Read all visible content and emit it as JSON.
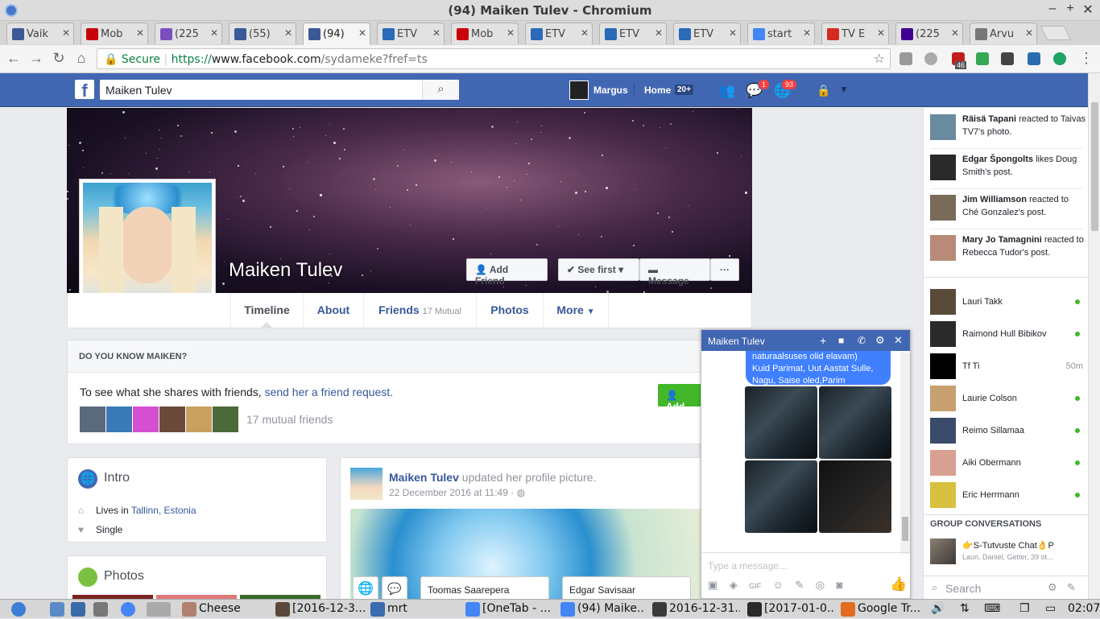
{
  "window": {
    "title": "(94) Maiken Tulev - Chromium"
  },
  "tabs": [
    {
      "label": "Vaik",
      "color": "#3b5998"
    },
    {
      "label": "Mob",
      "color": "#c7000b"
    },
    {
      "label": "(225",
      "color": "#7b4fbf"
    },
    {
      "label": "(55)",
      "color": "#3b5998"
    },
    {
      "label": "(94)",
      "color": "#3b5998"
    },
    {
      "label": "ETV",
      "color": "#2a6ab8"
    },
    {
      "label": "Mob",
      "color": "#c7000b"
    },
    {
      "label": "ETV",
      "color": "#2a6ab8"
    },
    {
      "label": "ETV",
      "color": "#2a6ab8"
    },
    {
      "label": "ETV",
      "color": "#2a6ab8"
    },
    {
      "label": "start",
      "color": "#4285f4"
    },
    {
      "label": "TV E",
      "color": "#d52b1e"
    },
    {
      "label": "(225",
      "color": "#400090"
    },
    {
      "label": "Arvu",
      "color": "#777777"
    }
  ],
  "address": {
    "secure": "Secure",
    "scheme": "https://",
    "host": "www.facebook.com",
    "path": "/sydameke?fref=ts"
  },
  "ext_badge": "46",
  "fb": {
    "search_value": "Maiken Tulev",
    "user": "Margus",
    "home": "Home",
    "home_count": "20+",
    "messages_badge": "1",
    "notif_badge": "93"
  },
  "profile": {
    "name": "Maiken Tulev",
    "add_friend": "Add Friend",
    "see_first": "See first",
    "message": "Message",
    "more_dots": "···",
    "tabs": {
      "timeline": "Timeline",
      "about": "About",
      "friends": "Friends",
      "friends_sub": "17 Mutual",
      "photos": "Photos",
      "more": "More"
    }
  },
  "know": {
    "header": "DO YOU KNOW MAIKEN?",
    "text": "To see what she shares with friends,",
    "link": "send her a friend request.",
    "mutual": "17 mutual friends",
    "add_btn": "Add"
  },
  "intro": {
    "title": "Intro",
    "lives_label": "Lives in",
    "lives_value": "Tallinn, Estonia",
    "status": "Single"
  },
  "photos_title": "Photos",
  "post": {
    "author": "Maiken Tulev",
    "action": "updated her profile picture.",
    "time": "22 December 2016 at 11:49 ·"
  },
  "ticker": [
    {
      "bold": "Räisä Tapani",
      "rest": "reacted to Taivas TV7's photo."
    },
    {
      "bold": "Edgar Špongolts",
      "rest": "likes Doug Smith's post."
    },
    {
      "bold": "Jim Williamson",
      "rest": "reacted to Ché Gonzalez's post."
    },
    {
      "bold": "Mary Jo Tamagnini",
      "rest": "reacted to Rebecca Tudor's post."
    }
  ],
  "friends": [
    {
      "name": "Lauri Takk",
      "status": "online"
    },
    {
      "name": "Raimond Hull Bibikov",
      "status": "online"
    },
    {
      "name": "Tf Ti",
      "status": "50m"
    },
    {
      "name": "Laurie Colson",
      "status": "online"
    },
    {
      "name": "Reimo Sillamaa",
      "status": "online"
    },
    {
      "name": "Aiki Obermann",
      "status": "online"
    },
    {
      "name": "Eric Herrmann",
      "status": "online"
    }
  ],
  "group": {
    "header": "GROUP CONVERSATIONS",
    "name": "👉S-Tutvuste Chat👌P",
    "members": "Lauri, Daniel, Getter, 39 ot..."
  },
  "chat_search": "Search",
  "chat": {
    "title": "Maiken Tulev",
    "message_lines": [
      "naturaalsuses olid elavam)",
      "Kuid Parimat, Uut Aastat Sulle,",
      "Nagu, Saise oled,Parim"
    ],
    "placeholder": "Type a message..."
  },
  "bottom_chats": [
    "Toomas Saarepera",
    "Edgar Savisaar"
  ],
  "taskbar": [
    {
      "label": "Cheese"
    },
    {
      "label": "[2016-12-3..."
    },
    {
      "label": "mrt"
    },
    {
      "label": "[OneTab - ..."
    },
    {
      "label": "(94) Maike..."
    },
    {
      "label": "2016-12-31..."
    },
    {
      "label": "[2017-01-0..."
    },
    {
      "label": "Google Tr..."
    }
  ],
  "clock": "02:07",
  "colors": {
    "fb_blue": "#4267b2",
    "link": "#365899",
    "green": "#42b72a",
    "messenger": "#4080ff"
  }
}
